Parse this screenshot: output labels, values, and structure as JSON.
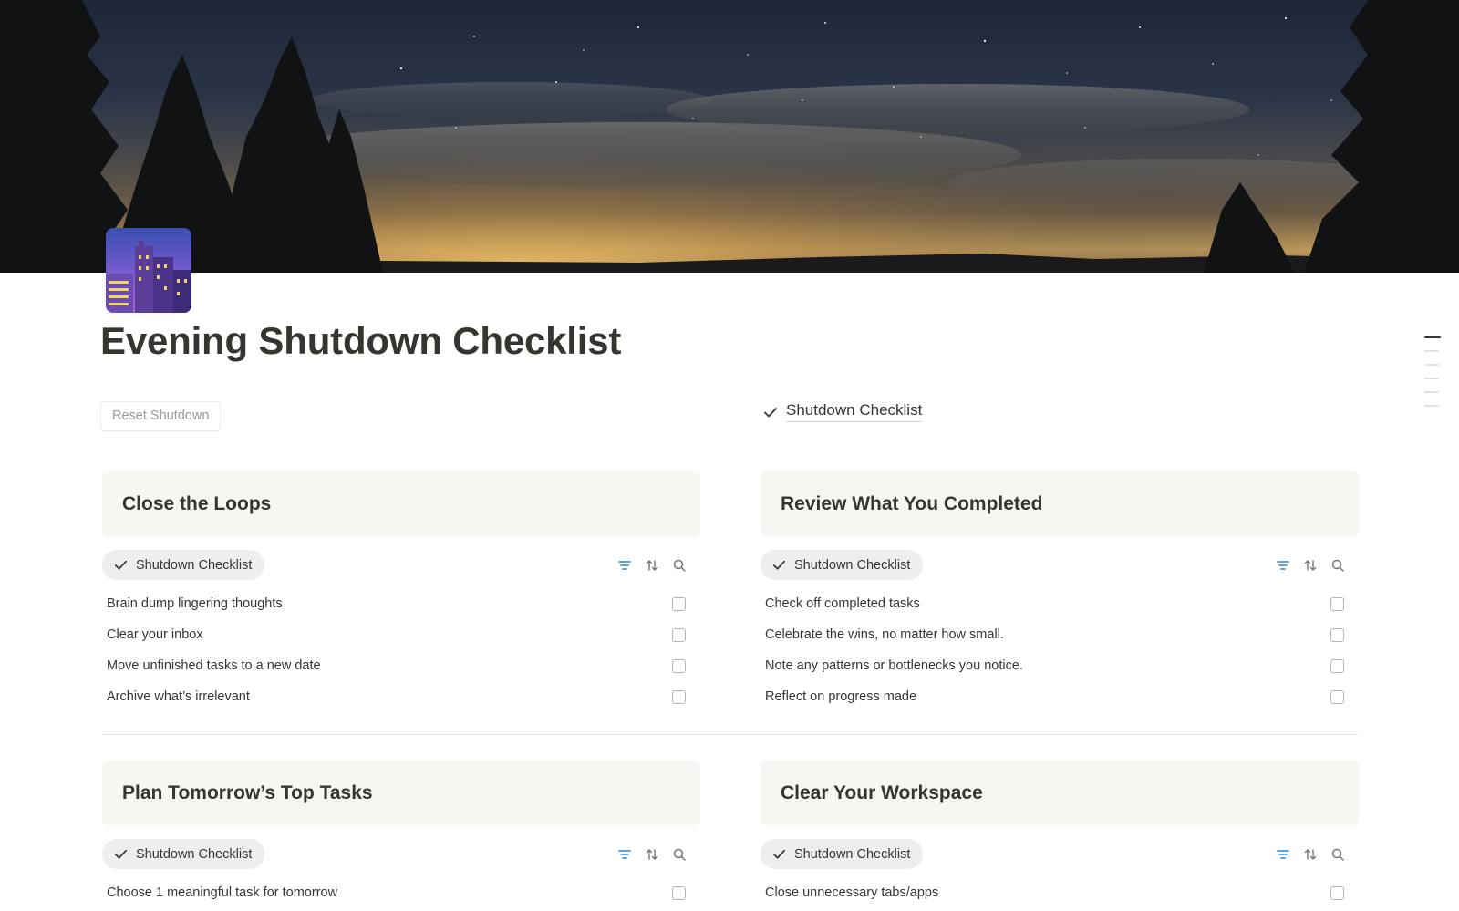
{
  "page": {
    "title": "Evening Shutdown Checklist",
    "icon": "night-city-icon",
    "cover": "night-sky-cover"
  },
  "top_controls": {
    "reset_button": "Reset Shutdown",
    "linked_view": "Shutdown Checklist"
  },
  "outline": {
    "count": 7,
    "active_index": 0
  },
  "sections": [
    {
      "heading": "Close the Loops",
      "view_label": "Shutdown Checklist",
      "items": [
        {
          "text": "Brain dump lingering thoughts",
          "checked": false
        },
        {
          "text": "Clear your inbox",
          "checked": false
        },
        {
          "text": "Move unfinished tasks to a new date",
          "checked": false
        },
        {
          "text": "Archive what’s irrelevant",
          "checked": false
        }
      ]
    },
    {
      "heading": "Review What You Completed",
      "view_label": "Shutdown Checklist",
      "items": [
        {
          "text": "Check off completed tasks",
          "checked": false
        },
        {
          "text": "Celebrate the wins, no matter how small.",
          "checked": false
        },
        {
          "text": "Note any patterns or bottlenecks you notice.",
          "checked": false
        },
        {
          "text": "Reflect on progress made",
          "checked": false
        }
      ]
    },
    {
      "heading": "Plan Tomorrow’s Top Tasks",
      "view_label": "Shutdown Checklist",
      "items": [
        {
          "text": "Choose 1 meaningful task for tomorrow",
          "checked": false
        }
      ]
    },
    {
      "heading": "Clear Your Workspace",
      "view_label": "Shutdown Checklist",
      "items": [
        {
          "text": "Close unnecessary tabs/apps",
          "checked": false
        }
      ]
    }
  ],
  "colors": {
    "text": "#37352f",
    "muted": "#9b9a97",
    "callout_bg": "#f7f6f3",
    "tab_bg": "#efeeec",
    "filter_icon": "#2383e2"
  }
}
